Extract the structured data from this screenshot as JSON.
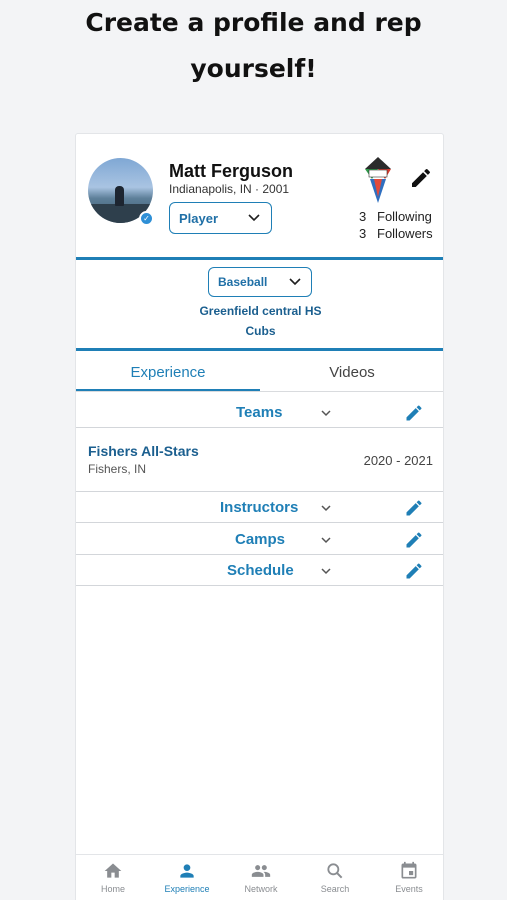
{
  "headline": {
    "line1": "Create a profile and rep",
    "line2": "yourself!"
  },
  "profile": {
    "name": "Matt Ferguson",
    "location_year": "Indianapolis, IN · 2001",
    "role": "Player",
    "following_count": "3",
    "following_label": "Following",
    "followers_count": "3",
    "followers_label": "Followers"
  },
  "sport": {
    "selected": "Baseball",
    "school": "Greenfield central HS",
    "team": "Cubs"
  },
  "tabs": [
    {
      "label": "Experience",
      "active": true
    },
    {
      "label": "Videos",
      "active": false
    }
  ],
  "sections": {
    "teams": "Teams",
    "instructors": "Instructors",
    "camps": "Camps",
    "schedule": "Schedule"
  },
  "team_entry": {
    "name": "Fishers All-Stars",
    "location": "Fishers, IN",
    "years": "2020 - 2021"
  },
  "bottom_nav": [
    {
      "label": "Home",
      "icon": "home-icon"
    },
    {
      "label": "Experience",
      "icon": "person-icon",
      "active": true
    },
    {
      "label": "Network",
      "icon": "people-icon"
    },
    {
      "label": "Search",
      "icon": "search-icon"
    },
    {
      "label": "Events",
      "icon": "calendar-icon"
    }
  ],
  "colors": {
    "accent": "#1f7fb6",
    "accent_dark": "#1b5f8f",
    "background": "#f3f4f6"
  }
}
